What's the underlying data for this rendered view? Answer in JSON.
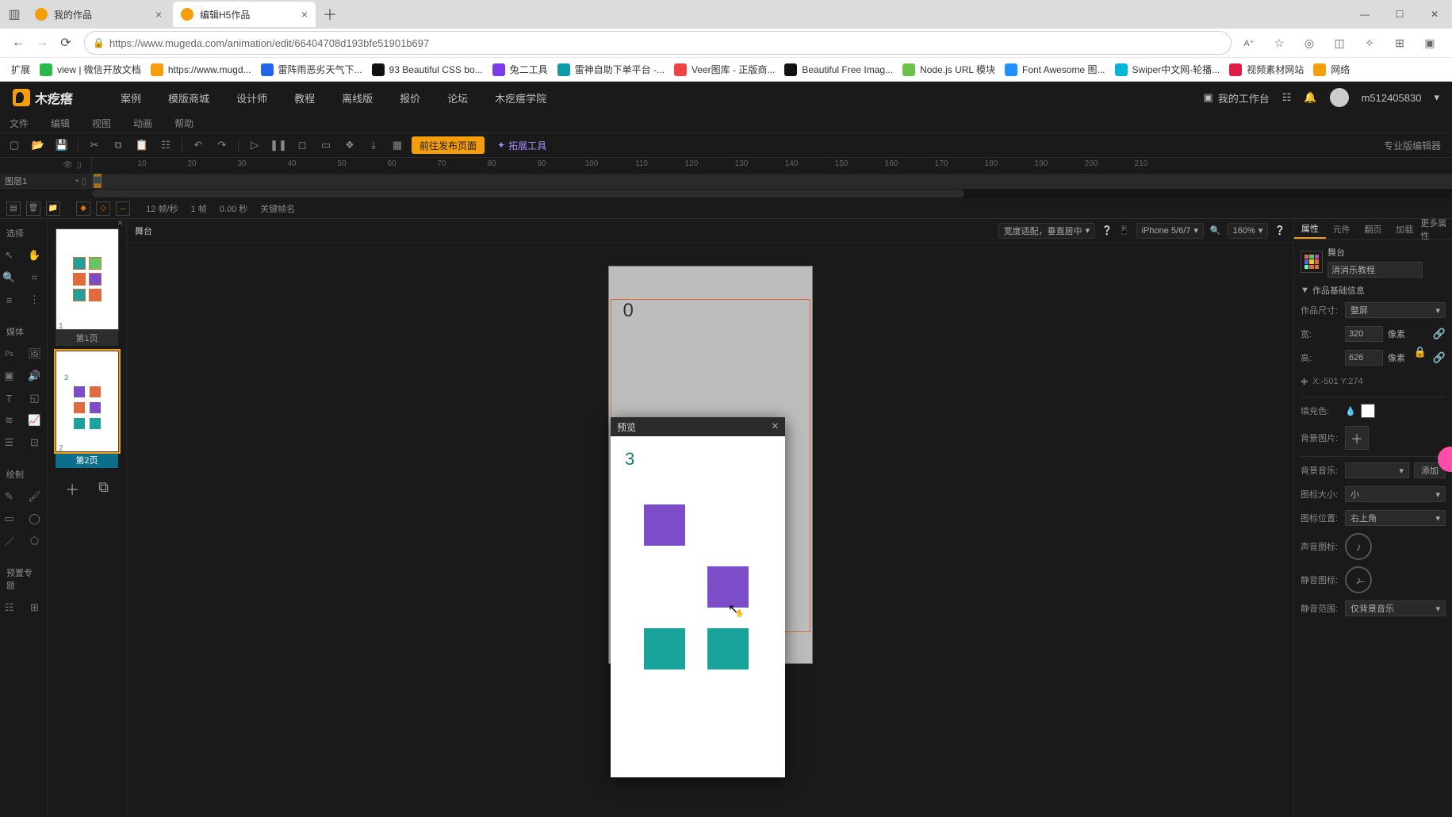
{
  "browser": {
    "tabs": [
      {
        "title": "我的作品",
        "active": false
      },
      {
        "title": "编辑H5作品",
        "active": true
      }
    ],
    "url": "https://www.mugeda.com/animation/edit/66404708d193bfe51901b697",
    "bookmarks_label": "扩展",
    "bookmarks": [
      {
        "label": "view | 微信开放文档",
        "color": "#2db84c"
      },
      {
        "label": "https://www.mugd...",
        "color": "#f59e0b"
      },
      {
        "label": "雷阵雨恶劣天气下...",
        "color": "#2563eb"
      },
      {
        "label": "93 Beautiful CSS bo...",
        "color": "#111"
      },
      {
        "label": "兔二工具",
        "color": "#7c3aed"
      },
      {
        "label": "雷神自助下单平台 -...",
        "color": "#0e9aa7"
      },
      {
        "label": "Veer图库 - 正版商...",
        "color": "#ef4444"
      },
      {
        "label": "Beautiful Free Imag...",
        "color": "#111"
      },
      {
        "label": "Node.js URL 模块",
        "color": "#6cc24a"
      },
      {
        "label": "Font Awesome 图...",
        "color": "#1e90ff"
      },
      {
        "label": "Swiper中文网-轮播...",
        "color": "#06b6d4"
      },
      {
        "label": "视频素材网站",
        "color": "#e11d48"
      },
      {
        "label": "网络",
        "color": "#f59e0b"
      }
    ]
  },
  "app": {
    "brand": "木疙瘩",
    "nav": [
      "案例",
      "模版商城",
      "设计师",
      "教程",
      "离线版",
      "报价",
      "论坛",
      "木疙瘩学院"
    ],
    "workspace_label": "我的工作台",
    "username": "m512405830",
    "menus": [
      "文件",
      "编辑",
      "视图",
      "动画",
      "帮助"
    ],
    "publish_btn": "前往发布页面",
    "expand_btn": "拓展工具",
    "editor_edition": "专业版编辑器"
  },
  "timeline": {
    "layer_name": "图层1",
    "ticks": [
      10,
      20,
      30,
      40,
      50,
      60,
      70,
      80,
      90,
      100,
      110,
      120,
      130,
      140,
      150,
      160,
      170,
      180,
      190,
      200,
      210
    ],
    "status": {
      "fps": "12 帧/秒",
      "frame": "1 帧",
      "time": "0.00 秒",
      "keyframe_label": "关键帧名"
    }
  },
  "left_sections": {
    "select": "选择",
    "media": "媒体",
    "draw": "绘制",
    "preset": "预置专题"
  },
  "pages": {
    "labels": [
      "第1页",
      "第2页"
    ],
    "colors": {
      "teal": "#1aa39b",
      "purple": "#7c4dc9",
      "orange": "#e06b3c",
      "green": "#5fc86b"
    }
  },
  "canvas": {
    "stage_label": "舞台",
    "adapt_label": "宽度适配，垂直居中",
    "device": "iPhone 5/6/7",
    "zoom": "160%",
    "score": "0"
  },
  "props": {
    "tabs": [
      "属性",
      "元件",
      "翻页",
      "加载",
      "更多属性"
    ],
    "stage_label": "舞台",
    "project_name": "消消乐教程",
    "section_basic": "作品基础信息",
    "size_label": "作品尺寸:",
    "size_value": "整屏",
    "w_label": "宽:",
    "w_value": "320",
    "w_unit": "像素",
    "h_label": "高:",
    "h_value": "626",
    "h_unit": "像素",
    "xy": "X:-501   Y:274",
    "fill_label": "填充色:",
    "bgimg_label": "背景图片:",
    "bgm_label": "背景音乐:",
    "add_label": "添加",
    "icon_size_label": "图标大小:",
    "icon_size_value": "小",
    "icon_pos_label": "图标位置:",
    "icon_pos_value": "右上角",
    "sound_label": "声音图标:",
    "mute_label": "静音图标:",
    "mute_scope_label": "静音范围:",
    "mute_scope_value": "仅背景音乐"
  },
  "preview": {
    "title": "预览",
    "counter": "3",
    "cells": [
      {
        "color": "#7c4dc9",
        "visible": true
      },
      {
        "color": "#7c4dc9",
        "visible": false
      },
      {
        "color": "#7c4dc9",
        "visible": false
      },
      {
        "color": "#7c4dc9",
        "visible": true
      },
      {
        "color": "#1aa39b",
        "visible": true
      },
      {
        "color": "#1aa39b",
        "visible": true
      }
    ]
  }
}
